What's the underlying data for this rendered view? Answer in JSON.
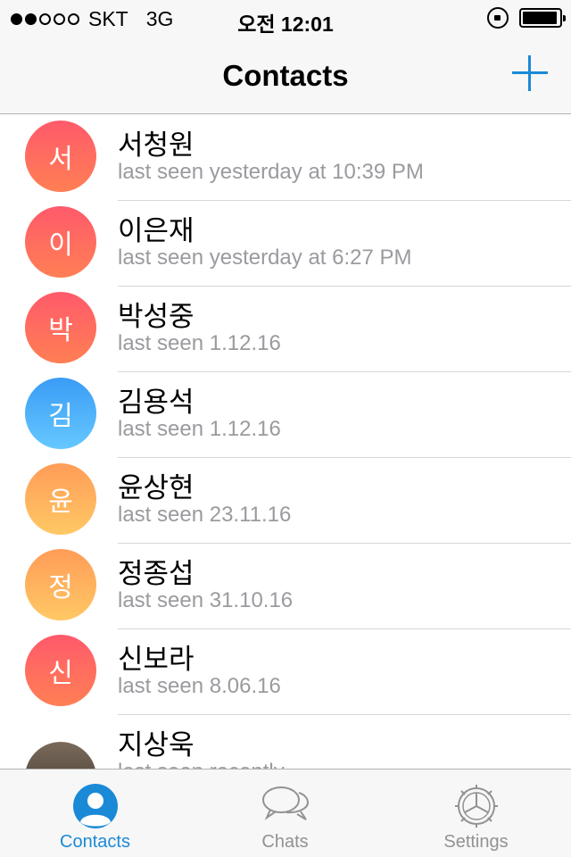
{
  "status_bar": {
    "carrier": "SKT",
    "network": "3G",
    "time": "오전 12:01",
    "signal_bars": 2,
    "battery_level": 0.95
  },
  "nav": {
    "title": "Contacts",
    "add_icon": "plus-icon"
  },
  "contacts": [
    {
      "initial": "서",
      "name": "서청원",
      "status": "last seen yesterday at 10:39 PM",
      "color": "red"
    },
    {
      "initial": "이",
      "name": "이은재",
      "status": "last seen yesterday at 6:27 PM",
      "color": "red"
    },
    {
      "initial": "박",
      "name": "박성중",
      "status": "last seen 1.12.16",
      "color": "red"
    },
    {
      "initial": "김",
      "name": "김용석",
      "status": "last seen 1.12.16",
      "color": "blue"
    },
    {
      "initial": "윤",
      "name": "윤상현",
      "status": "last seen 23.11.16",
      "color": "orange"
    },
    {
      "initial": "정",
      "name": "정종섭",
      "status": "last seen 31.10.16",
      "color": "orange"
    },
    {
      "initial": "신",
      "name": "신보라",
      "status": "last seen 8.06.16",
      "color": "red"
    },
    {
      "initial": "",
      "name": "지상욱",
      "status": "last seen recently",
      "color": "photo"
    }
  ],
  "tabs": [
    {
      "label": "Contacts",
      "icon": "person-icon",
      "active": true
    },
    {
      "label": "Chats",
      "icon": "chat-bubbles-icon",
      "active": false
    },
    {
      "label": "Settings",
      "icon": "gear-icon",
      "active": false
    }
  ],
  "colors": {
    "accent": "#1b8ad6",
    "inactive_tab": "#929292",
    "status_text": "#9a9a9f"
  }
}
